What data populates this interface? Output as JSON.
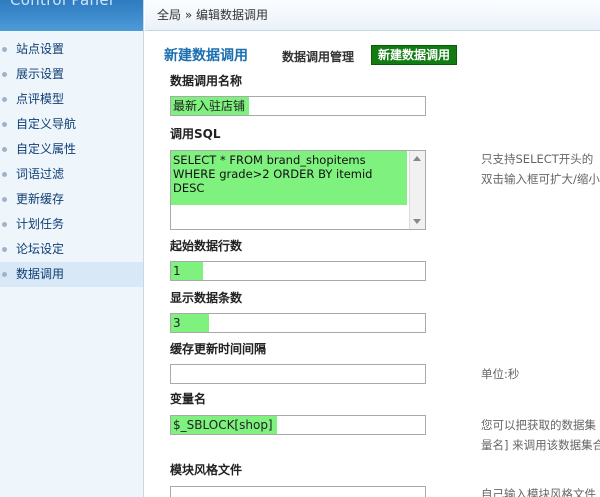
{
  "sidebar": {
    "brand": "Control Panel",
    "items": [
      {
        "label": "站点设置"
      },
      {
        "label": "展示设置"
      },
      {
        "label": "点评模型"
      },
      {
        "label": "自定义导航"
      },
      {
        "label": "自定义属性"
      },
      {
        "label": "词语过滤"
      },
      {
        "label": "更新缓存"
      },
      {
        "label": "计划任务"
      },
      {
        "label": "论坛设定"
      },
      {
        "label": "数据调用"
      }
    ]
  },
  "breadcrumb": "全局 » 编辑数据调用",
  "header": {
    "title": "新建数据调用",
    "tab_manage": "数据调用管理",
    "tab_new": "新建数据调用"
  },
  "form": {
    "name_label": "数据调用名称",
    "name_value": "最新入驻店铺",
    "sql_label": "调用SQL",
    "sql_value": "SELECT * FROM brand_shopitems WHERE grade>2 ORDER BY itemid DESC",
    "sql_help_1": "只支持SELECT开头的",
    "sql_help_2": "双击输入框可扩大/缩小",
    "start_label": "起始数据行数",
    "start_value": "1",
    "count_label": "显示数据条数",
    "count_value": "3",
    "cache_label": "缓存更新时间间隔",
    "cache_value": "",
    "cache_help": "单位:秒",
    "var_label": "变量名",
    "var_value": "$_SBLOCK[shop]",
    "var_help_1": "您可以把获取的数据集",
    "var_help_2": "量名] 来调用该数据集合",
    "tpl_label": "模块风格文件",
    "tpl_help": "自己输入模块风格文件"
  },
  "colors": {
    "highlight": "#7ef17e",
    "tab_active_bg": "#127c12",
    "title": "#1b6fb0",
    "sidebar_text": "#0e3e74"
  }
}
